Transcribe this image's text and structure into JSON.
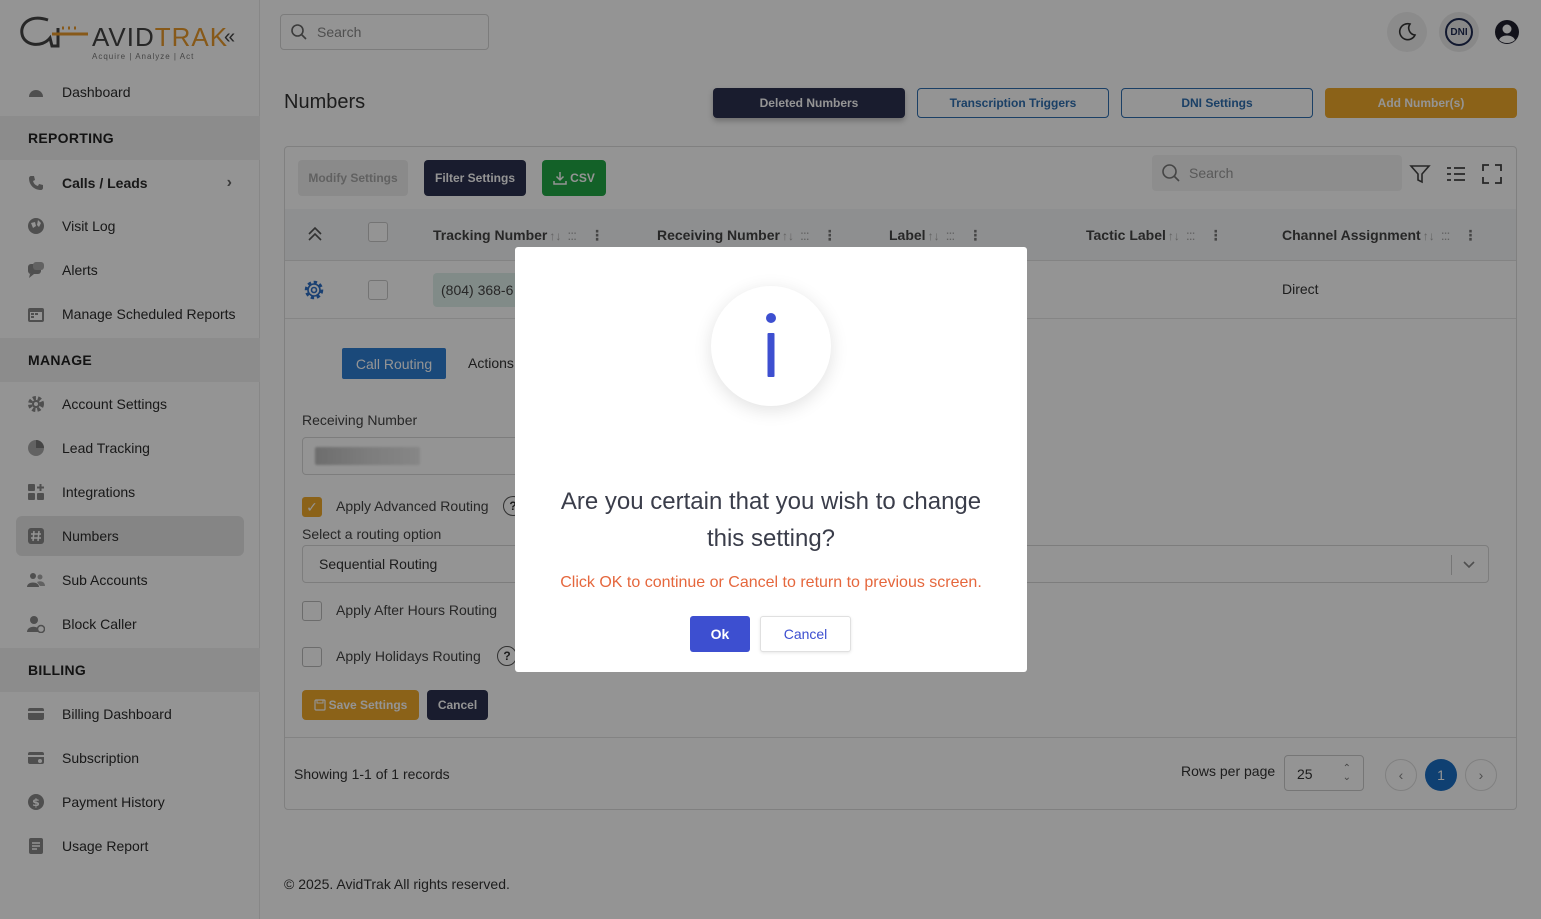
{
  "brand": {
    "name_left": "AVID",
    "name_right": "TRAK",
    "tagline": "Acquire  |  Analyze  |  Act",
    "collapse_glyph": "«"
  },
  "sidebar": {
    "top_item": {
      "label": "Dashboard",
      "icon": "dashboard-icon"
    },
    "sections": [
      {
        "heading": "REPORTING",
        "items": [
          {
            "label": "Calls / Leads",
            "icon": "phone-icon",
            "bold": true,
            "chevron": "›"
          },
          {
            "label": "Visit Log",
            "icon": "globe-icon"
          },
          {
            "label": "Alerts",
            "icon": "chat-icon"
          },
          {
            "label": "Manage Scheduled Reports",
            "icon": "calendar-icon"
          }
        ]
      },
      {
        "heading": "MANAGE",
        "items": [
          {
            "label": "Account Settings",
            "icon": "gear-icon"
          },
          {
            "label": "Lead Tracking",
            "icon": "pie-chart-icon"
          },
          {
            "label": "Integrations",
            "icon": "grid-plus-icon"
          },
          {
            "label": "Numbers",
            "icon": "hash-icon",
            "active": true
          },
          {
            "label": "Sub Accounts",
            "icon": "users-icon"
          },
          {
            "label": "Block Caller",
            "icon": "user-block-icon"
          }
        ]
      },
      {
        "heading": "BILLING",
        "items": [
          {
            "label": "Billing Dashboard",
            "icon": "card-icon"
          },
          {
            "label": "Subscription",
            "icon": "card-refresh-icon"
          },
          {
            "label": "Payment History",
            "icon": "dollar-icon"
          },
          {
            "label": "Usage Report",
            "icon": "report-icon"
          }
        ]
      }
    ]
  },
  "topbar": {
    "search_placeholder": "Search",
    "dni_badge": "DNI"
  },
  "page": {
    "title": "Numbers",
    "header_buttons": {
      "deleted": "Deleted Numbers",
      "transcription": "Transcription Triggers",
      "dni_settings": "DNI Settings",
      "add": "Add Number(s)"
    }
  },
  "table": {
    "toolbar": {
      "modify": "Modify Settings",
      "filter": "Filter Settings",
      "csv": "CSV",
      "search_placeholder": "Search"
    },
    "columns": [
      {
        "label": "Tracking Number",
        "sort": "↑↓",
        "grip": ":::",
        "menu": "⋮"
      },
      {
        "label": "Receiving Number",
        "sort": "↑↓",
        "grip": ":::",
        "menu": "⋮"
      },
      {
        "label": "Label",
        "sort": "↑↓",
        "grip": ":::",
        "menu": "⋮"
      },
      {
        "label": "Tactic Label",
        "sort": "↑↓",
        "grip": ":::",
        "menu": "⋮"
      },
      {
        "label": "Channel Assignment",
        "sort": "↑↓",
        "grip": ":::",
        "menu": "⋮"
      }
    ],
    "row": {
      "tracking_number": "(804) 368-6",
      "channel_assignment": "Direct"
    },
    "detail": {
      "tab_call_routing": "Call Routing",
      "tab_actions": "Actions",
      "receiving_number_label": "Receiving Number",
      "advanced_routing_label": "Apply Advanced Routing",
      "advanced_routing_checked": true,
      "routing_option_label": "Select a routing option",
      "routing_option_value": "Sequential Routing",
      "after_hours_label": "Apply After Hours Routing",
      "holidays_label": "Apply Holidays Routing",
      "help_glyph": "?",
      "check_glyph": "✓",
      "save_button": "Save Settings",
      "cancel_button": "Cancel"
    },
    "footer": {
      "showing": "Showing 1-1 of 1 records",
      "rows_per_page_label": "Rows per page",
      "rows_per_page_value": "25",
      "current_page": "1",
      "prev_glyph": "‹",
      "next_glyph": "›"
    }
  },
  "copyright": "© 2025. AvidTrak All rights reserved.",
  "modal": {
    "title": "Are you certain that you wish to change this setting?",
    "subtitle": "Click OK to continue or Cancel to return to previous screen.",
    "ok": "Ok",
    "cancel": "Cancel",
    "icon": "info-icon"
  },
  "colors": {
    "navy": "#2c3150",
    "accent_orange": "#f0a92a",
    "link_blue": "#2f6fb0",
    "csv_green": "#22a745",
    "modal_blue": "#3d4fd0",
    "warning_text": "#e5673d"
  }
}
